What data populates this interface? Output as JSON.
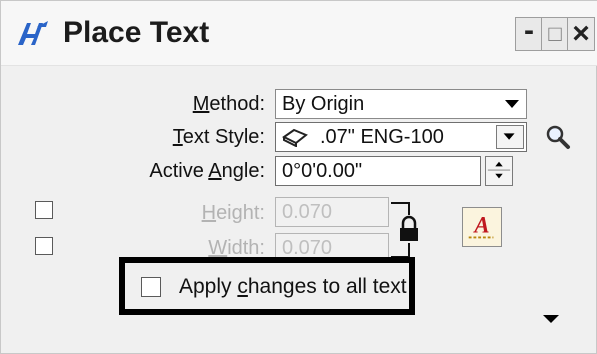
{
  "window": {
    "title": "Place Text",
    "controls": {
      "minimize": "-",
      "maximize": "□",
      "close": "×"
    }
  },
  "form": {
    "method": {
      "label_pre": "",
      "label_u": "M",
      "label_post": "ethod:",
      "value": "By Origin"
    },
    "text_style": {
      "label_pre": "",
      "label_u": "T",
      "label_post": "ext Style:",
      "value": ".07\"  ENG-100"
    },
    "active_angle": {
      "label_pre": "Active ",
      "label_u": "A",
      "label_post": "ngle:",
      "value": "0°0'0.00\""
    },
    "height": {
      "label_pre": "",
      "label_u": "H",
      "label_post": "eight:",
      "value": "0.070"
    },
    "width": {
      "label_pre": "",
      "label_u": "W",
      "label_post": "idth:",
      "value": "0.070"
    },
    "apply_changes": {
      "label_pre": "Apply ",
      "label_u": "c",
      "label_post": "hanges to all text"
    }
  },
  "icons": {
    "app": "bentley-text-icon",
    "text_style_symbol": "text-style-glyph-icon",
    "magnifier": "magnifier-icon",
    "lock": "lock-icon",
    "text_attributes": "text-attributes-icon",
    "expand": "expand-arrow-icon"
  },
  "colors": {
    "accent_blue": "#2a64c8",
    "highlight_border": "#000000",
    "text_attr_red": "#c0181f"
  }
}
